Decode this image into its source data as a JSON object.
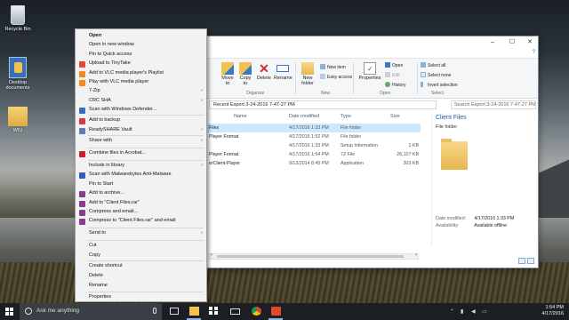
{
  "desktop": {
    "icons": [
      {
        "label": "Recycle Bin"
      },
      {
        "label": "Desktop documents"
      },
      {
        "label": "WIU"
      }
    ]
  },
  "explorer": {
    "window_controls": {
      "minimize": "–",
      "maximize": "☐",
      "close": "✕"
    },
    "ribbon": {
      "organize": {
        "group_label": "Organize",
        "move_to": "Move to",
        "copy_to": "Copy to",
        "delete": "Delete",
        "rename": "Rename"
      },
      "new": {
        "group_label": "New",
        "new_folder": "New folder",
        "new_item": "New item",
        "easy_access": "Easy access"
      },
      "open": {
        "group_label": "Open",
        "properties": "Properties",
        "open": "Open",
        "edit": "Edit",
        "history": "History"
      },
      "select": {
        "group_label": "Select",
        "select_all": "Select all",
        "select_none": "Select none",
        "invert_selection": "Invert selection"
      }
    },
    "address": "Recent Export 3-24-2016 7-47-27 PM",
    "search_placeholder": "Search Export 3-24-2016 7-47-27 PM",
    "columns": {
      "name": "Name",
      "date_modified": "Date modified",
      "type": "Type",
      "size": "Size"
    },
    "files": [
      {
        "name": "Files",
        "date": "4/17/2016 1:33 PM",
        "type": "File folder",
        "size": ""
      },
      {
        "name": "Player Format",
        "date": "4/17/2016 1:52 PM",
        "type": "File folder",
        "size": ""
      },
      {
        "name": "",
        "date": "4/17/2016 1:33 PM",
        "type": "Setup Information",
        "size": "1 KB"
      },
      {
        "name": "Player Format",
        "date": "4/17/2016 1:54 PM",
        "type": "7Z File",
        "size": "26,107 KB"
      },
      {
        "name": "erClient-Player",
        "date": "9/12/2014 8:45 PM",
        "type": "Application",
        "size": "303 KB"
      }
    ],
    "details": {
      "title": "Client Files",
      "subtitle": "File folder",
      "date_modified_label": "Date modified:",
      "date_modified": "4/17/2016 1:33 PM",
      "availability_label": "Availability:",
      "availability": "Available offline"
    }
  },
  "context_menu": {
    "items": [
      {
        "label": "Open",
        "bold": true
      },
      {
        "label": "Open in new window"
      },
      {
        "label": "Pin to Quick access"
      },
      {
        "label": "Upload to TinyTake",
        "icon": "tinytake-icon",
        "color": "#e8492e"
      },
      {
        "label": "Add to VLC media player's Playlist",
        "icon": "vlc-icon",
        "color": "#f08a1c"
      },
      {
        "label": "Play with VLC media player",
        "icon": "vlc-icon",
        "color": "#f08a1c"
      },
      {
        "label": "7-Zip",
        "submenu": true
      },
      {
        "label": "CRC SHA",
        "submenu": true
      },
      {
        "label": "Scan with Windows Defender...",
        "icon": "defender-icon",
        "color": "#3b6cc0"
      },
      {
        "label": "Add to backup",
        "icon": "backup-icon",
        "color": "#d23b3b"
      },
      {
        "label": "ReadySHARE Vault",
        "icon": "vault-icon",
        "color": "#5e7fae",
        "submenu": true
      },
      {
        "label": "Share with",
        "submenu": true
      },
      {
        "label": "Combine files in Acrobat...",
        "icon": "acrobat-icon",
        "color": "#c8202a"
      },
      {
        "label": "Include in library",
        "submenu": true
      },
      {
        "label": "Scan with Malwarebytes Anti-Malware",
        "icon": "malwarebytes-icon",
        "color": "#2f62b5"
      },
      {
        "label": "Pin to Start"
      },
      {
        "label": "Add to archive...",
        "icon": "rar-icon",
        "color": "#8b3d8d"
      },
      {
        "label": "Add to \"Client Files.rar\"",
        "icon": "rar-icon",
        "color": "#8b3d8d"
      },
      {
        "label": "Compress and email...",
        "icon": "rar-icon",
        "color": "#8b3d8d"
      },
      {
        "label": "Compress to \"Client Files.rar\" and email",
        "icon": "rar-icon",
        "color": "#8b3d8d"
      },
      {
        "label": "Send to",
        "submenu": true
      },
      {
        "label": "Cut"
      },
      {
        "label": "Copy"
      },
      {
        "label": "Create shortcut"
      },
      {
        "label": "Delete"
      },
      {
        "label": "Rename"
      },
      {
        "label": "Properties"
      }
    ]
  },
  "taskbar": {
    "search_placeholder": "Ask me anything",
    "clock_time": "1:54 PM",
    "clock_date": "4/17/2016"
  }
}
